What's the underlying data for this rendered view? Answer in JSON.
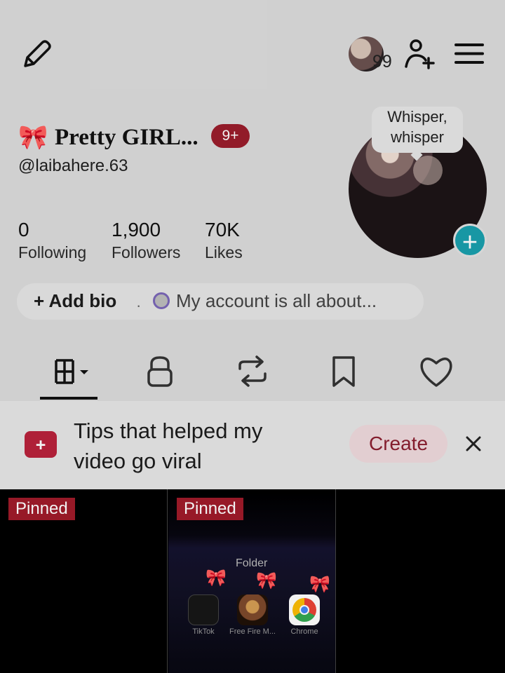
{
  "top_bar": {
    "avatar_count": "99"
  },
  "profile": {
    "name_emoji": "🎀",
    "display_name": "Pretty GIRL...",
    "badge": "9+",
    "username": "@laibahere.63",
    "stats": [
      {
        "value": "0",
        "label": "Following"
      },
      {
        "value": "1,900",
        "label": "Followers"
      },
      {
        "value": "70K",
        "label": "Likes"
      }
    ],
    "bubble_text_line1": "Whisper,",
    "bubble_text_line2": "whisper"
  },
  "bio": {
    "add_bio": "Add bio",
    "separator": "·",
    "about": "My account is all about..."
  },
  "tabs": [
    "videos",
    "private",
    "reposts",
    "saved",
    "liked"
  ],
  "tips": {
    "text_line1": "Tips that helped my",
    "text_line2": "video go viral",
    "create": "Create"
  },
  "grid": {
    "items": [
      {
        "pinned": "Pinned"
      },
      {
        "pinned": "Pinned",
        "folder": "Folder",
        "apps": [
          "TikTok",
          "Free Fire M...",
          "Chrome"
        ]
      },
      {}
    ]
  }
}
